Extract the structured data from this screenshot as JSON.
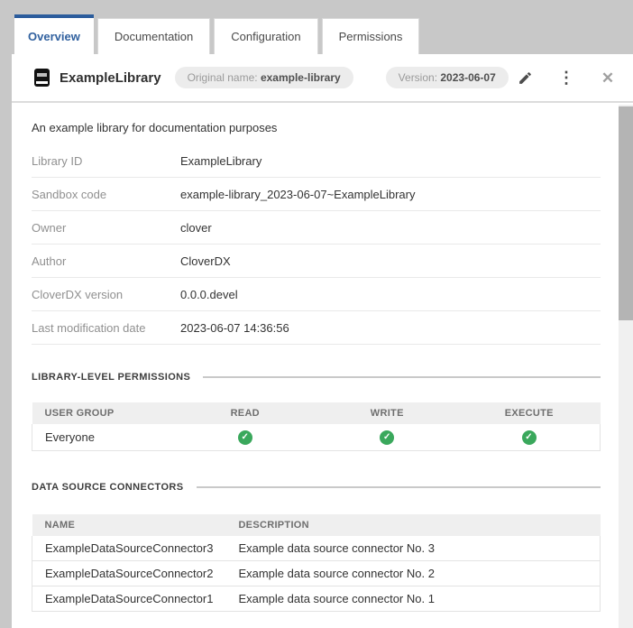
{
  "tabs": [
    {
      "label": "Overview",
      "active": true
    },
    {
      "label": "Documentation",
      "active": false
    },
    {
      "label": "Configuration",
      "active": false
    },
    {
      "label": "Permissions",
      "active": false
    }
  ],
  "header": {
    "title": "ExampleLibrary",
    "original_name_label": "Original name:",
    "original_name_value": "example-library",
    "version_label": "Version:",
    "version_value": "2023-06-07"
  },
  "icons": {
    "edit": "edit-pencil",
    "kebab": "⋮",
    "close": "✕",
    "check": "✓"
  },
  "description": "An example library for documentation purposes",
  "info_rows": [
    {
      "label": "Library ID",
      "value": "ExampleLibrary"
    },
    {
      "label": "Sandbox code",
      "value": "example-library_2023-06-07~ExampleLibrary"
    },
    {
      "label": "Owner",
      "value": "clover"
    },
    {
      "label": "Author",
      "value": "CloverDX"
    },
    {
      "label": "CloverDX version",
      "value": "0.0.0.devel"
    },
    {
      "label": "Last modification date",
      "value": "2023-06-07 14:36:56"
    }
  ],
  "permissions_section": {
    "heading": "LIBRARY-LEVEL PERMISSIONS",
    "columns": [
      "USER GROUP",
      "READ",
      "WRITE",
      "EXECUTE"
    ],
    "rows": [
      {
        "group": "Everyone",
        "read": true,
        "write": true,
        "execute": true
      }
    ]
  },
  "connectors_section": {
    "heading": "DATA SOURCE CONNECTORS",
    "columns": [
      "NAME",
      "DESCRIPTION"
    ],
    "rows": [
      {
        "name": "ExampleDataSourceConnector3",
        "description": "Example data source connector No. 3"
      },
      {
        "name": "ExampleDataSourceConnector2",
        "description": "Example data source connector No. 2"
      },
      {
        "name": "ExampleDataSourceConnector1",
        "description": "Example data source connector No. 1"
      }
    ]
  },
  "colors": {
    "accent_blue": "#2b5c9c",
    "success_green": "#3aa85c",
    "outer_background": "#c8c8c8",
    "table_header_bg": "#efefef",
    "scroll_thumb": "#b4b4b4"
  }
}
